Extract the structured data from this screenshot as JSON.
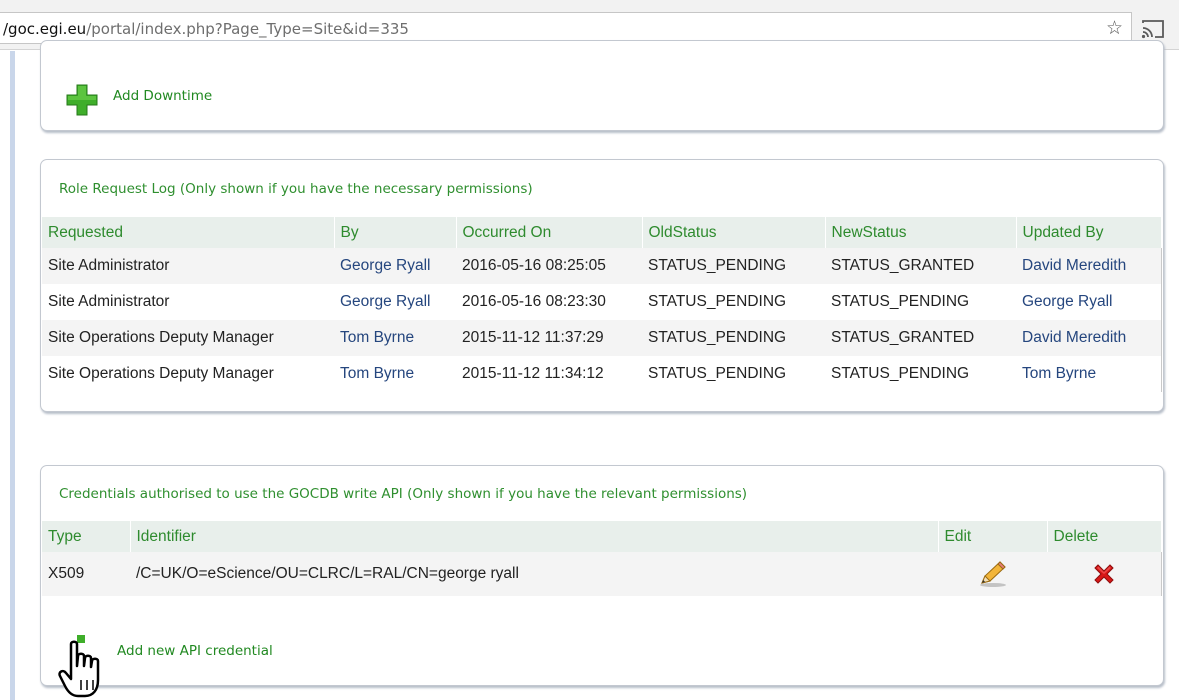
{
  "browser": {
    "url_host": "/goc.egi.eu",
    "url_path": "/portal/index.php?Page_Type=Site&id=335",
    "bookmark_icon": "star-icon",
    "cast_icon": "cast-icon"
  },
  "downtime_panel": {
    "add_label": "Add Downtime",
    "add_icon": "green-plus-icon"
  },
  "role_log": {
    "title": "Role Request Log (Only shown if you have the necessary permissions)",
    "columns": [
      "Requested",
      "By",
      "Occurred On",
      "OldStatus",
      "NewStatus",
      "Updated By"
    ],
    "rows": [
      [
        "Site Administrator",
        "George Ryall",
        "2016-05-16 08:25:05",
        "STATUS_PENDING",
        "STATUS_GRANTED",
        "David Meredith"
      ],
      [
        "Site Administrator",
        "George Ryall",
        "2016-05-16 08:23:30",
        "STATUS_PENDING",
        "STATUS_PENDING",
        "George Ryall"
      ],
      [
        "Site Operations Deputy Manager",
        "Tom Byrne",
        "2015-11-12 11:37:29",
        "STATUS_PENDING",
        "STATUS_GRANTED",
        "David Meredith"
      ],
      [
        "Site Operations Deputy Manager",
        "Tom Byrne",
        "2015-11-12 11:34:12",
        "STATUS_PENDING",
        "STATUS_PENDING",
        "Tom Byrne"
      ]
    ]
  },
  "api_credentials": {
    "title": "Credentials authorised to use the GOCDB write API (Only shown if you have the relevant permissions)",
    "columns": [
      "Type",
      "Identifier",
      "Edit",
      "Delete"
    ],
    "rows": [
      [
        "X509",
        "/C=UK/O=eScience/OU=CLRC/L=RAL/CN=george ryall"
      ]
    ],
    "edit_icon": "pencil-icon",
    "delete_icon": "red-cross-icon",
    "add_label": "Add new API credential"
  },
  "cursor": "hand-pointer-icon",
  "colors": {
    "link_green": "#218921",
    "header_bg": "#e8efeb",
    "name_link": "#25467e",
    "delete_red": "#d81818"
  }
}
